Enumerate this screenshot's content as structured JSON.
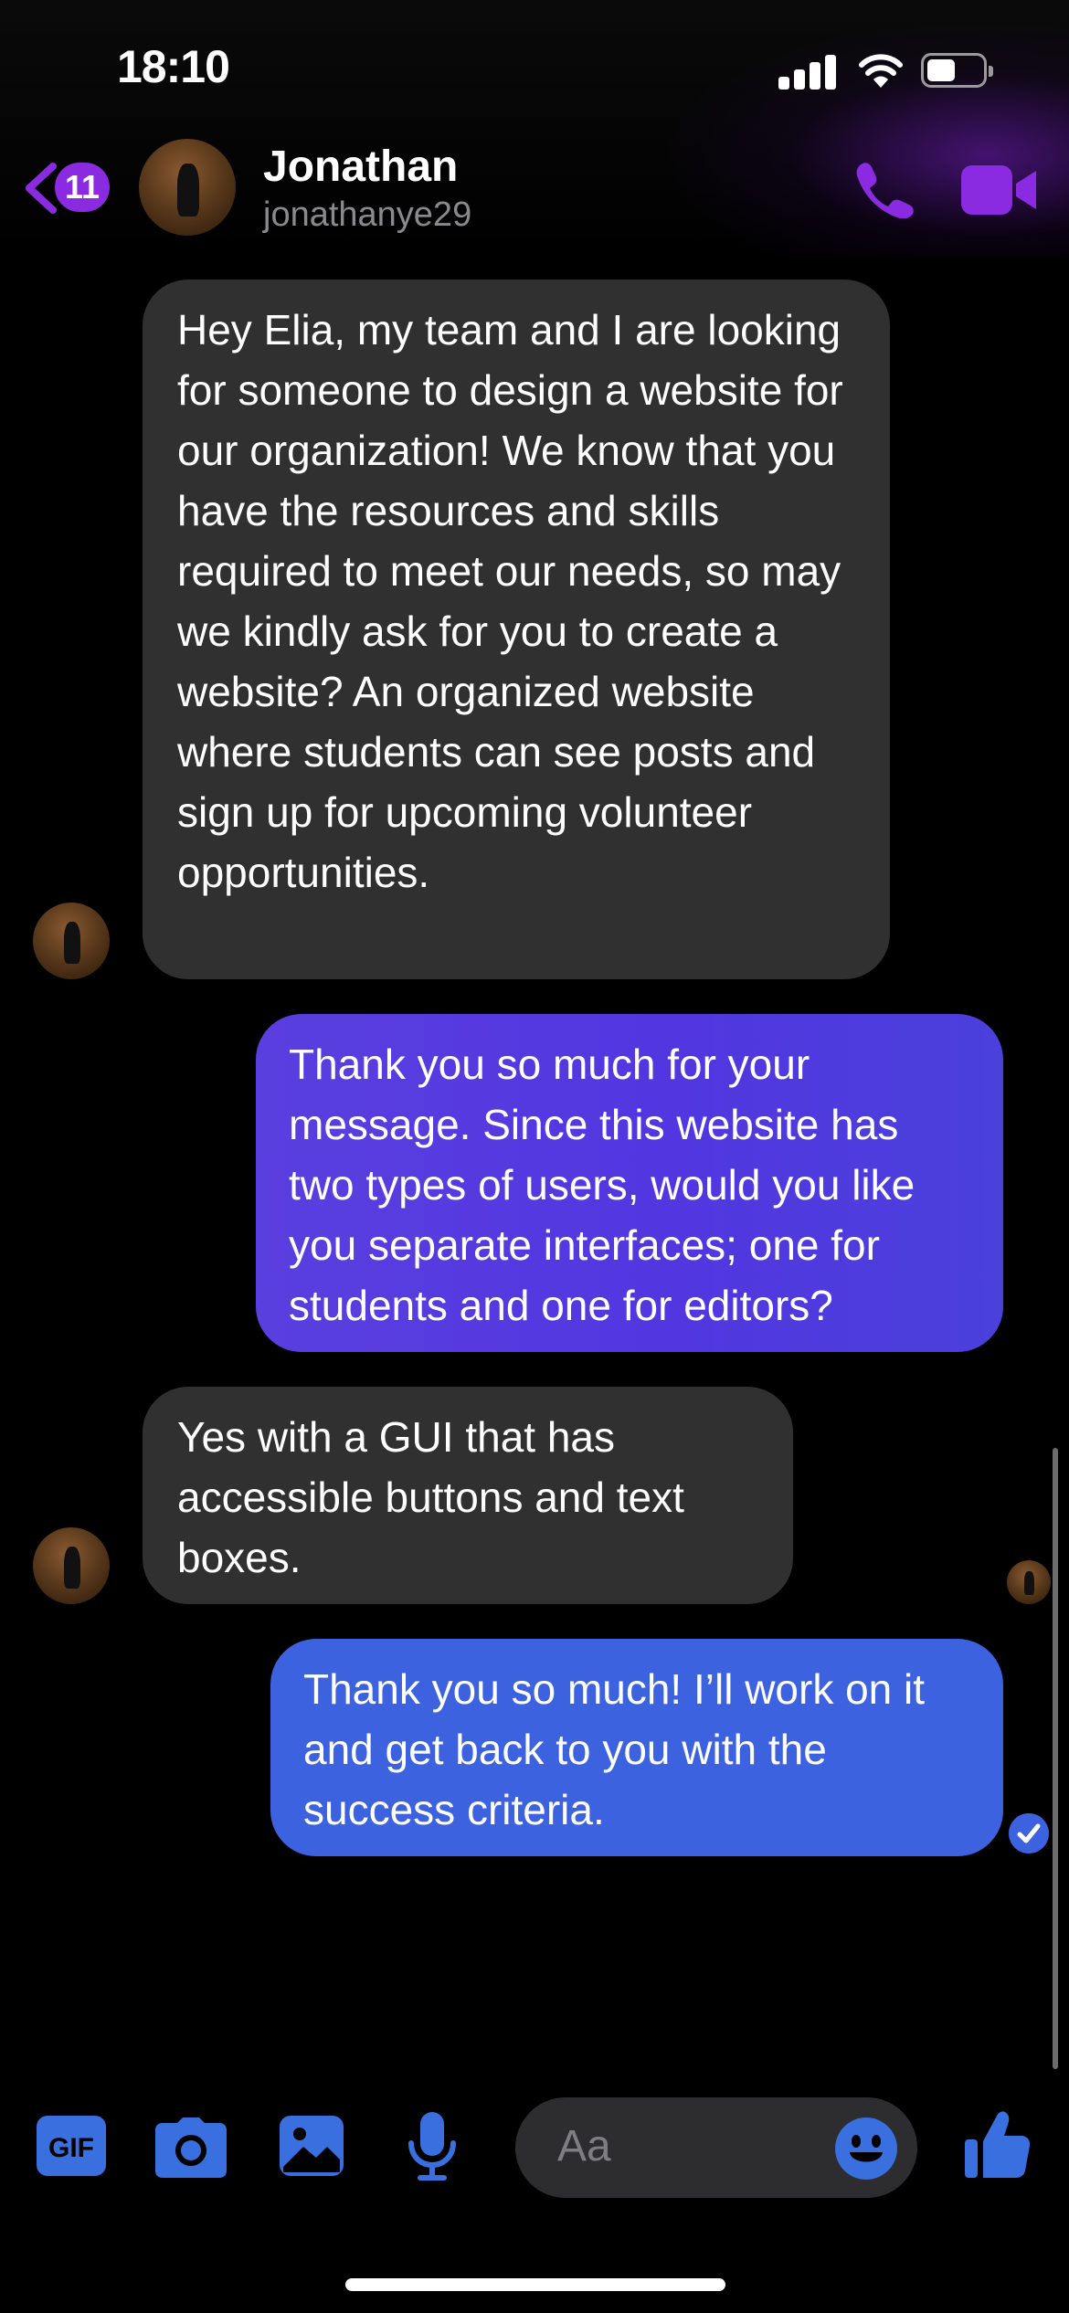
{
  "status_bar": {
    "time": "18:10"
  },
  "header": {
    "unread_count": "11",
    "contact_name": "Jonathan",
    "contact_username": "jonathanye29"
  },
  "messages": [
    {
      "from": "contact",
      "text": "Hey Elia, my team and I are looking for someone to design a website for our organization! We know that you have the resources and skills required to meet our needs, so may we kindly ask for you to create a website? An organized website where students can see posts and sign up for upcoming volunteer opportunities."
    },
    {
      "from": "me",
      "text": "Thank you so much for your message. Since this website has two types of users, would you like you separate interfaces; one for students and one for editors?"
    },
    {
      "from": "contact",
      "text": "Yes with a GUI that has accessible buttons and text boxes."
    },
    {
      "from": "me",
      "text": "Thank you so much! I’ll work on it and get back to you with the success criteria."
    }
  ],
  "composer": {
    "gif_label": "GIF",
    "placeholder": "Aa"
  },
  "colors": {
    "accent_purple": "#8a2be2",
    "outgoing_purple": "#5236e0",
    "outgoing_blue": "#3c62df",
    "incoming_gray": "#303030",
    "composer_blue": "#3a6fe0"
  }
}
